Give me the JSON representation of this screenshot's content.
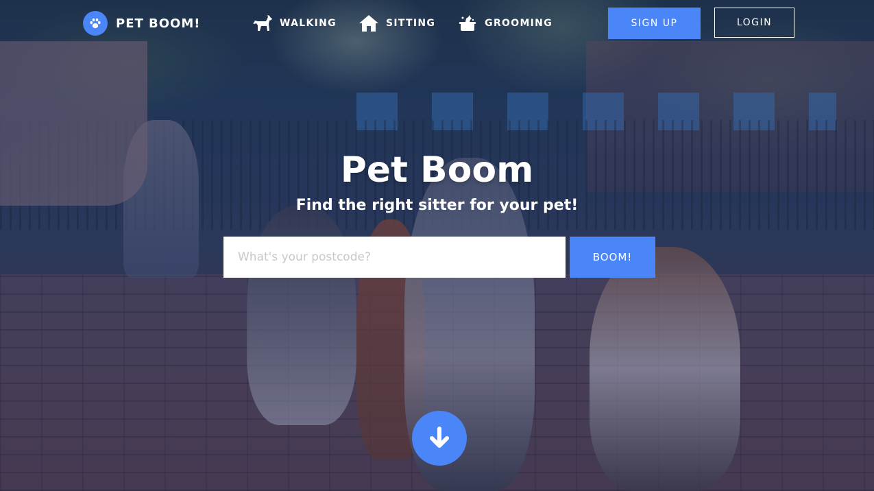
{
  "brand": {
    "name": "PET BOOM!",
    "logo_icon": "paw-icon",
    "accent_color": "#4a86f7"
  },
  "nav": {
    "items": [
      {
        "label": "WALKING",
        "icon": "dog-icon"
      },
      {
        "label": "SITTING",
        "icon": "house-icon"
      },
      {
        "label": "GROOMING",
        "icon": "grooming-icon"
      }
    ]
  },
  "auth": {
    "signup_label": "SIGN UP",
    "login_label": "LOGIN"
  },
  "hero": {
    "title": "Pet Boom",
    "subtitle": "Find the right sitter for your pet!"
  },
  "search": {
    "placeholder": "What's your postcode?",
    "value": "",
    "button_label": "BOOM!"
  },
  "scroll": {
    "icon": "arrow-down-icon"
  }
}
